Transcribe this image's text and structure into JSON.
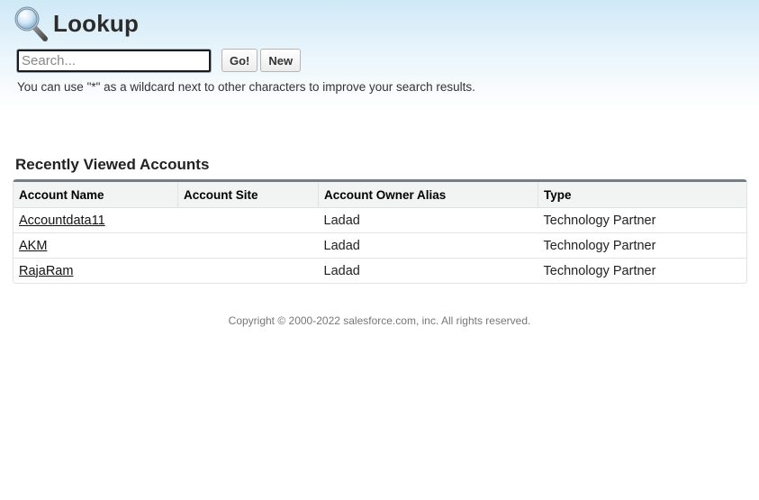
{
  "header": {
    "title": "Lookup",
    "icon": "magnifying-glass-icon"
  },
  "search": {
    "placeholder": "Search...",
    "value": "",
    "go_label": "Go!",
    "new_label": "New",
    "hint": "You can use \"*\" as a wildcard next to other characters to improve your search results."
  },
  "results": {
    "title": "Recently Viewed Accounts",
    "columns": [
      "Account Name",
      "Account Site",
      "Account Owner Alias",
      "Type"
    ],
    "rows": [
      {
        "name": "Accountdata11",
        "site": "",
        "owner": "Ladad",
        "type": "Technology Partner"
      },
      {
        "name": "AKM",
        "site": "",
        "owner": "Ladad",
        "type": "Technology Partner"
      },
      {
        "name": "RajaRam",
        "site": "",
        "owner": "Ladad",
        "type": "Technology Partner"
      }
    ]
  },
  "footer": {
    "copyright": "Copyright © 2000-2022 salesforce.com, inc. All rights reserved."
  },
  "colors": {
    "header_gradient_top": "#cfe9f6",
    "table_top_border": "#747e87",
    "header_row_bg": "#f2f3f3"
  }
}
